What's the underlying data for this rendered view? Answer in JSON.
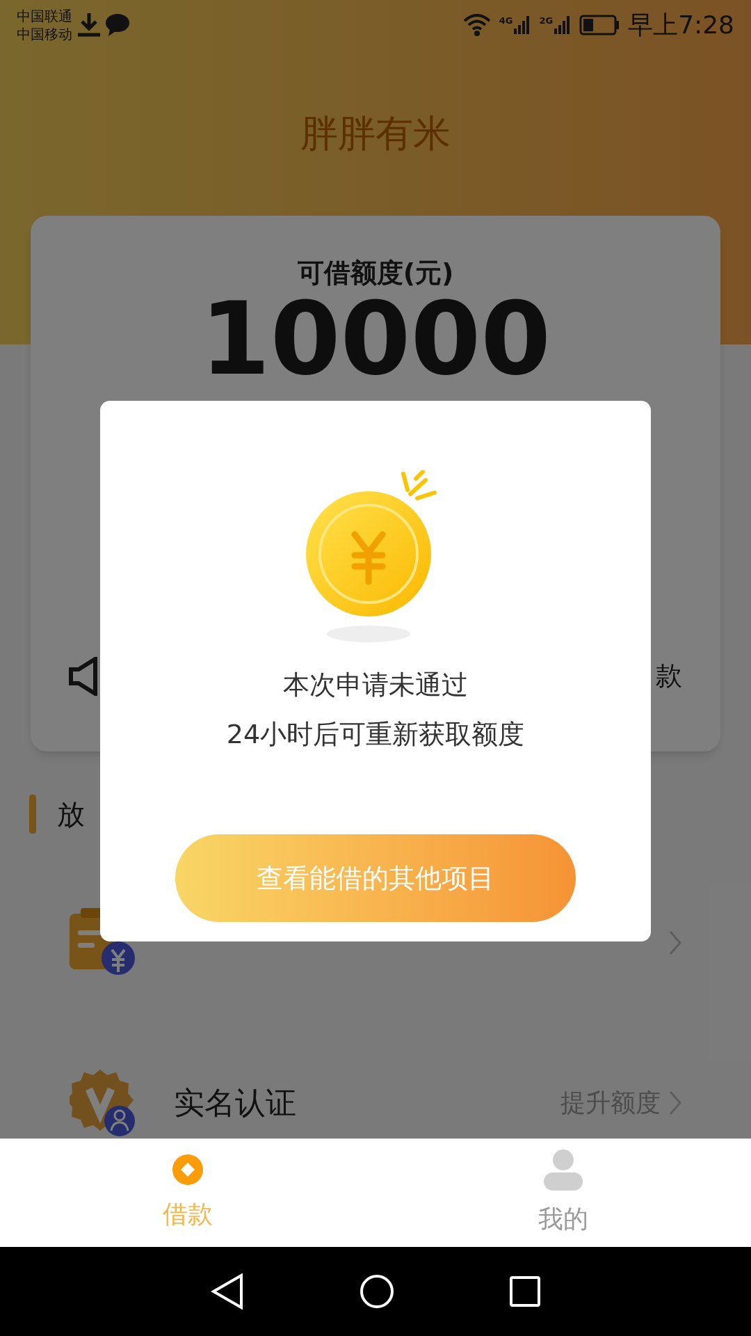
{
  "status_bar": {
    "carriers": [
      "中国联通",
      "中国移动"
    ],
    "networks": [
      "4G",
      "2G"
    ],
    "time": "早上7:28"
  },
  "header": {
    "title": "胖胖有米"
  },
  "credit_card": {
    "label": "可借额度(元)",
    "amount": "10000",
    "notice_right": "款"
  },
  "section": {
    "title": "放"
  },
  "menu": [
    {
      "kind": "loan"
    },
    {
      "kind": "verify",
      "title": "实名认证",
      "action": "提升额度"
    }
  ],
  "dialog": {
    "line_1": "本次申请未通过",
    "line_2": "24小时后可重新获取额度",
    "button": "查看能借的其他项目"
  },
  "tabs": [
    {
      "label": "借款",
      "selected": true
    },
    {
      "label": "我的",
      "selected": false
    }
  ]
}
